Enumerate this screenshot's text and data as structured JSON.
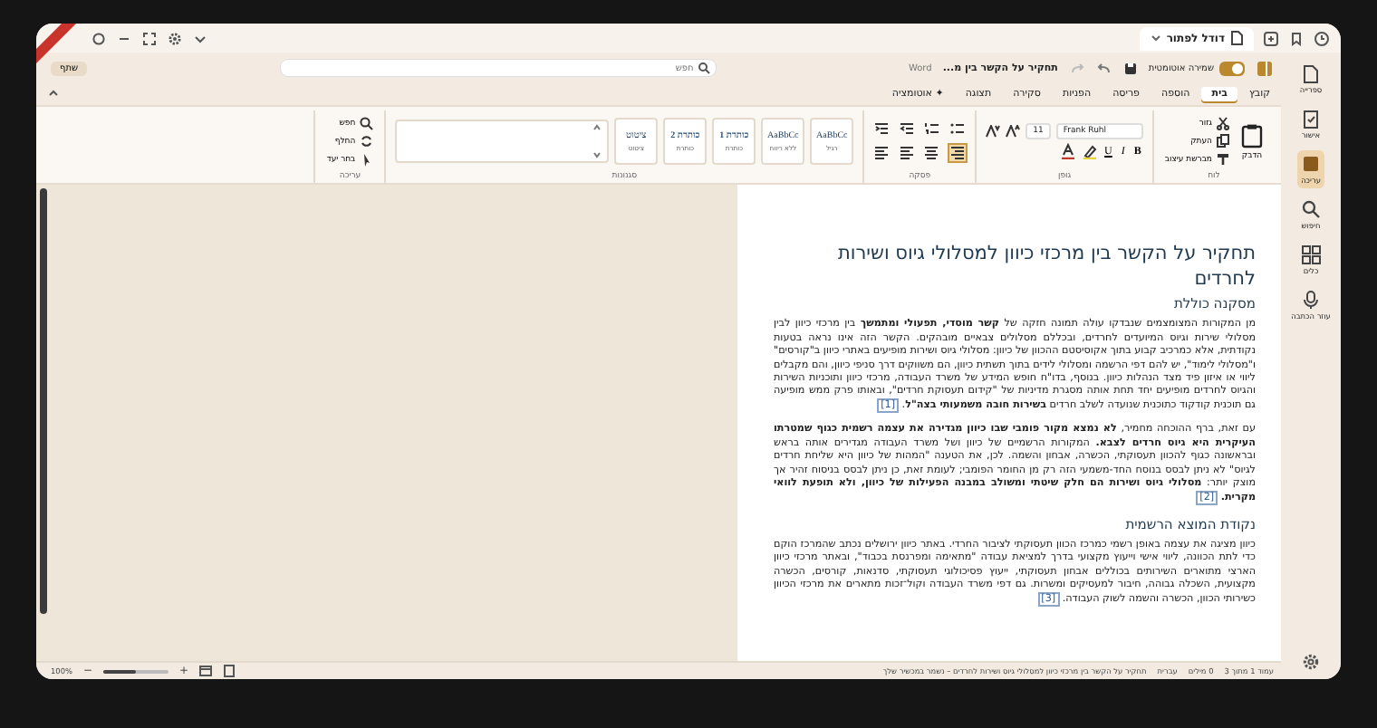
{
  "browser_tab": {
    "title": "דודל לפתור"
  },
  "title_bar": {
    "document_title": "תחקיר על הקשר בין מ...",
    "app_name": "Word",
    "autosave": {
      "label": "שמירה אוטומטית",
      "on": true
    },
    "search": {
      "placeholder": "חפש"
    },
    "share_button": "שתף"
  },
  "ribbon_tabs": [
    {
      "label": "קובץ",
      "selected": false
    },
    {
      "label": "בית",
      "selected": true
    },
    {
      "label": "הוספה",
      "selected": false
    },
    {
      "label": "פריסה",
      "selected": false
    },
    {
      "label": "הפניות",
      "selected": false
    },
    {
      "label": "סקירה",
      "selected": false
    },
    {
      "label": "תצוגה",
      "selected": false
    },
    {
      "label": "✦ אוטומציה",
      "selected": false
    }
  ],
  "ribbon": {
    "clipboard": {
      "label": "לוח",
      "paste": "הדבק",
      "items": [
        "גזור",
        "העתק",
        "מברשת עיצוב"
      ]
    },
    "font": {
      "label": "גופן",
      "font_name": "Frank Ruhl",
      "size": "11",
      "format_buttons": [
        "B",
        "I",
        "U"
      ]
    },
    "paragraph": {
      "label": "פסקה"
    },
    "styles": {
      "label": "סגנונות",
      "items": [
        {
          "sample": "AaBbCc",
          "name": "רגיל"
        },
        {
          "sample": "AaBbCc",
          "name": "ללא ריווח"
        },
        {
          "sample": "כותרת 1",
          "name": "כותרת"
        },
        {
          "sample": "כותרת 2",
          "name": "כותרת"
        },
        {
          "sample": "ציטוט",
          "name": "ציטוט"
        }
      ]
    },
    "editing": {
      "label": "עריכה",
      "items": [
        "חפש",
        "החלף",
        "בחר יעד"
      ]
    }
  },
  "document": {
    "title": "תחקיר על הקשר בין מרכזי כיוון למסלולי גיוס ושירות לחרדים",
    "sections": [
      {
        "heading": "מסקנה כוללת",
        "paragraphs": [
          {
            "text": "מן המקורות המצומצמים שנבדקו עולה תמונה חזקה של **קשר מוסדי, תפעולי ומתמשך** בין מרכזי כיוון לבין מסלולי שירות וגיוס המיועדים לחרדים, ובכללם מסלולים צבאיים מובהקים. הקשר הזה אינו נראה בטעות נקודתית, אלא כמרכיב קבוע בתוך אקוסיסטם ההכוון של כיוון: מסלולי גיוס ושירות מופיעים באתרי כיוון ב\"קורסים\" ו\"מסלולי לימוד\", יש להם דפי הרשמה ומסלולי לידים בתוך תשתית כיוון, הם משווקים דרך סניפי כיוון, והם מקבלים ליווי או איזון פיד מצד הנהלות כיוון. בנוסף, בדו\"ח חופש המידע של משרד העבודה, מרכזי כיוון ותוכניות השירות והגיוס לחרדים מופיעים יחד תחת אותה מסגרת מדיניות של \"קידום תעסוקת חרדים\", ובאותו פרק ממש מופיעה גם תוכנית קודקוד כתוכנית שנועדה לשלב חרדים **בשירות חובה משמעותי בצה\"ל**.",
            "cite": "[1]"
          },
          {
            "text": "עם זאת, ברף ההוכחה מחמיר, **לא נמצא מקור פומבי שבו כיוון מגדירה את עצמה רשמית כגוף שמטרתו העיקרית היא גיוס חרדים לצבא.** המקורות הרשמיים של כיוון ושל משרד העבודה מגדירים אותה בראש ובראשונה כגוף להכוון תעסוקתי, הכשרה, אבחון והשמה. לכן, את הטענה \"המהות של כיוון היא שליחת חרדים לגיוס\" לא ניתן לבסס בנוסח החד-משמעי הזה רק מן החומר הפומבי; לעומת זאת, כן ניתן לבסס בניסוח זהיר אך מוצק יותר: **מסלולי גיוס ושירות הם חלק שיטתי ומשולב במבנה הפעילות של כיוון, ולא תופעת לוואי מקרית.**",
            "cite": "[2]"
          }
        ]
      },
      {
        "heading": "נקודת המוצא הרשמית",
        "paragraphs": [
          {
            "text": "כיוון מציגה את עצמה באופן רשמי כמרכז הכוון תעסוקתי לציבור החרדי. באתר כיוון ירושלים נכתב שהמרכז הוקם כדי לתת הכוונה, ליווי אישי וייעוץ מקצועי בדרך למציאת עבודה \"מתאימה ומפרנסת בכבוד\", ובאתר מרכזי כיוון הארצי מתוארים השירותים בכוללים אבחון תעסוקתי, ייעוץ פסיכולוגי תעסוקתי, סדנאות, קורסים, הכשרה מקצועית, השכלה גבוהה, חיבור למעסיקים ומשרות. גם דפי משרד העבודה וקול־זכות מתארים את מרכזי הכיוון כשירותי הכוון, הכשרה והשמה לשוק העבודה.",
            "cite": "[3]"
          }
        ]
      }
    ]
  },
  "sidebar": {
    "items": [
      {
        "label": "ספרייה",
        "selected": false
      },
      {
        "label": "אישור",
        "selected": false
      },
      {
        "label": "עריכה",
        "selected": true
      },
      {
        "label": "חיפוש",
        "selected": false
      },
      {
        "label": "כלים",
        "selected": false
      },
      {
        "label": "עוזר הכתבה",
        "selected": false
      }
    ]
  },
  "status_bar": {
    "items": [
      "עמוד 1 מתוך 3",
      "0 מילים",
      "עברית",
      "תחקיר על הקשר בין מרכזי כיוון למסלולי גיוס ושירות לחרדים – נשמר במכשיר שלך"
    ],
    "zoom": "100%",
    "zoom_out": "−",
    "zoom_in": "+",
    "zoom_slider": {
      "level": 0.5
    }
  }
}
